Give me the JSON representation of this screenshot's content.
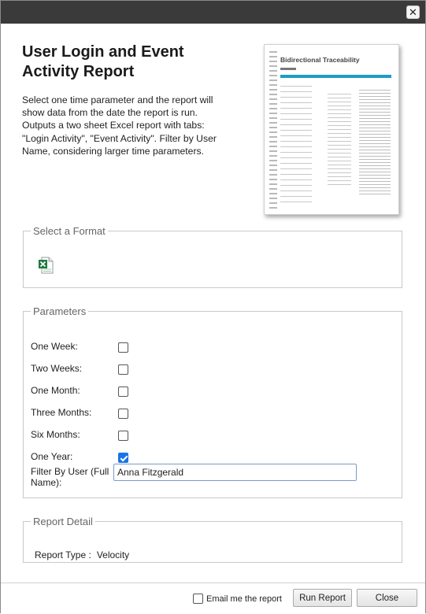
{
  "dialog": {
    "close_glyph": "✕",
    "title": "User Login and Event Activity Report",
    "description": "Select one time parameter and the report will show data from the date the report is run. Outputs a two sheet Excel report with tabs: \"Login Activity\", \"Event Activity\". Filter by User Name, considering larger time parameters.",
    "thumbnail_title": "Bidirectional Traceability"
  },
  "format": {
    "legend": "Select a Format",
    "icon": "excel-icon"
  },
  "parameters": {
    "legend": "Parameters",
    "options": [
      {
        "label": "One Week:",
        "checked": false
      },
      {
        "label": "Two Weeks:",
        "checked": false
      },
      {
        "label": "One Month:",
        "checked": false
      },
      {
        "label": "Three Months:",
        "checked": false
      },
      {
        "label": "Six Months:",
        "checked": false
      },
      {
        "label": "One Year:",
        "checked": true
      }
    ],
    "filter_label": "Filter By User (Full Name):",
    "filter_value": "Anna Fitzgerald"
  },
  "detail": {
    "legend": "Report Detail",
    "type_label": "Report Type :",
    "type_value": "Velocity"
  },
  "footer": {
    "email_label": "Email me the report",
    "email_checked": false,
    "run_label": "Run Report",
    "close_label": "Close"
  },
  "colors": {
    "titlebar": "#3a3a3a",
    "accent": "#1a73e8",
    "excel_green": "#1d7a3e"
  }
}
